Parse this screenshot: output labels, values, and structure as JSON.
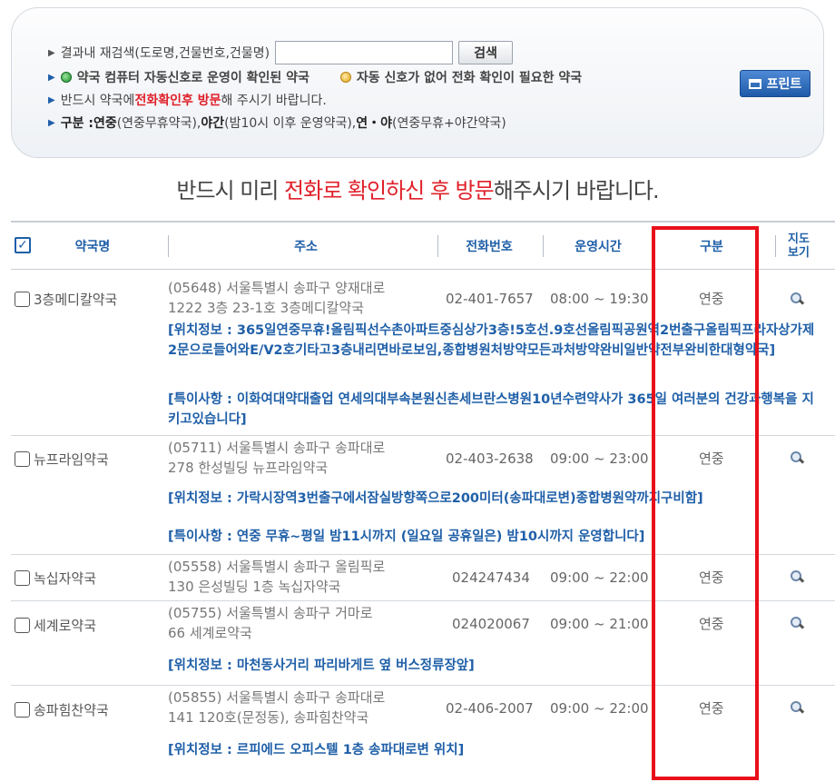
{
  "search": {
    "label": "결과내 재검색(도로명,건물번호,건물명)",
    "input_value": "",
    "button_label": "검색"
  },
  "legend": {
    "green_text": "약국 컴퓨터 자동신호로 운영이 확인된 약국",
    "yellow_text": "자동 신호가 없어 전화 확인이 필요한 약국",
    "line3_prefix": "반드시 약국에 ",
    "line3_highlight": "전화확인후 방문",
    "line3_suffix": "해 주시기 바랍니다.",
    "line4_label": "구분 : ",
    "line4_a": "연중",
    "line4_a_desc": "(연중무휴약국), ",
    "line4_b": "야간",
    "line4_b_desc": "(밤10시 이후 운영약국), ",
    "line4_c": "연・야",
    "line4_c_desc": "(연중무휴+야간약국)"
  },
  "print_button": "프린트",
  "notice": {
    "prefix": "반드시 미리 ",
    "highlight": "전화로 확인하신 후 방문",
    "suffix": "해주시기 바랍니다."
  },
  "table": {
    "headers": {
      "name": "약국명",
      "address": "주소",
      "phone": "전화번호",
      "hours": "운영시간",
      "kind": "구분",
      "map_line1": "지도",
      "map_line2": "보기"
    },
    "rows": [
      {
        "name": "3층메디칼약국",
        "addr1": "(05648) 서울특별시 송파구 양재대로",
        "addr2": "1222 3층 23-1호 3층메디칼약국",
        "phone": "02-401-7657",
        "hours": "08:00 ~ 19:30",
        "kind": "연중",
        "location": "[위치정보 : 365일연중무휴!올림픽선수촌아파트중심상가3층!5호선.9호선올림픽공원역2번출구올림픽프라자상가제2문으로들어와E/V2호기타고3층내리면바로보임,종합병원처방약모든과처방약완비일반약전부완비한대형약국]",
        "remark": "[특이사항 : 이화여대약대출업 연세의대부속본원신촌세브란스병원10년수련약사가 365일 여러분의 건강과행복을 지키고있습니다]"
      },
      {
        "name": "뉴프라임약국",
        "addr1": "(05711) 서울특별시 송파구 송파대로",
        "addr2": "278 한성빌딩 뉴프라임약국",
        "phone": "02-403-2638",
        "hours": "09:00 ~ 23:00",
        "kind": "연중",
        "location": "[위치정보 : 가락시장역3번출구에서잠실방향쪽으로200미터(송파대로변)종합병원약까지구비함]",
        "remark": "[특이사항 : 연중 무휴~평일 밤11시까지 (일요일 공휴일은) 밤10시까지 운영합니다]"
      },
      {
        "name": "녹십자약국",
        "addr1": "(05558) 서울특별시 송파구 올림픽로",
        "addr2": "130 은성빌딩 1층 녹십자약국",
        "phone": "024247434",
        "hours": "09:00 ~ 22:00",
        "kind": "연중"
      },
      {
        "name": "세계로약국",
        "addr1": "(05755) 서울특별시 송파구 거마로",
        "addr2": "66 세계로약국",
        "phone": "024020067",
        "hours": "09:00 ~ 21:00",
        "kind": "연중",
        "location": "[위치정보 : 마천동사거리 파리바게트 옆 버스정류장앞]"
      },
      {
        "name": "송파힘찬약국",
        "addr1": "(05855) 서울특별시 송파구 송파대로",
        "addr2": "141 120호(문정동), 송파힘찬약국",
        "phone": "02-406-2007",
        "hours": "09:00 ~ 22:00",
        "kind": "연중",
        "location": "[위치정보 : 르피에드 오피스텔 1층 송파대로변 위치]"
      }
    ]
  },
  "colors": {
    "accent_blue": "#1f5fa8",
    "highlight_red": "#e0202a",
    "frame_red": "#e8101a"
  }
}
